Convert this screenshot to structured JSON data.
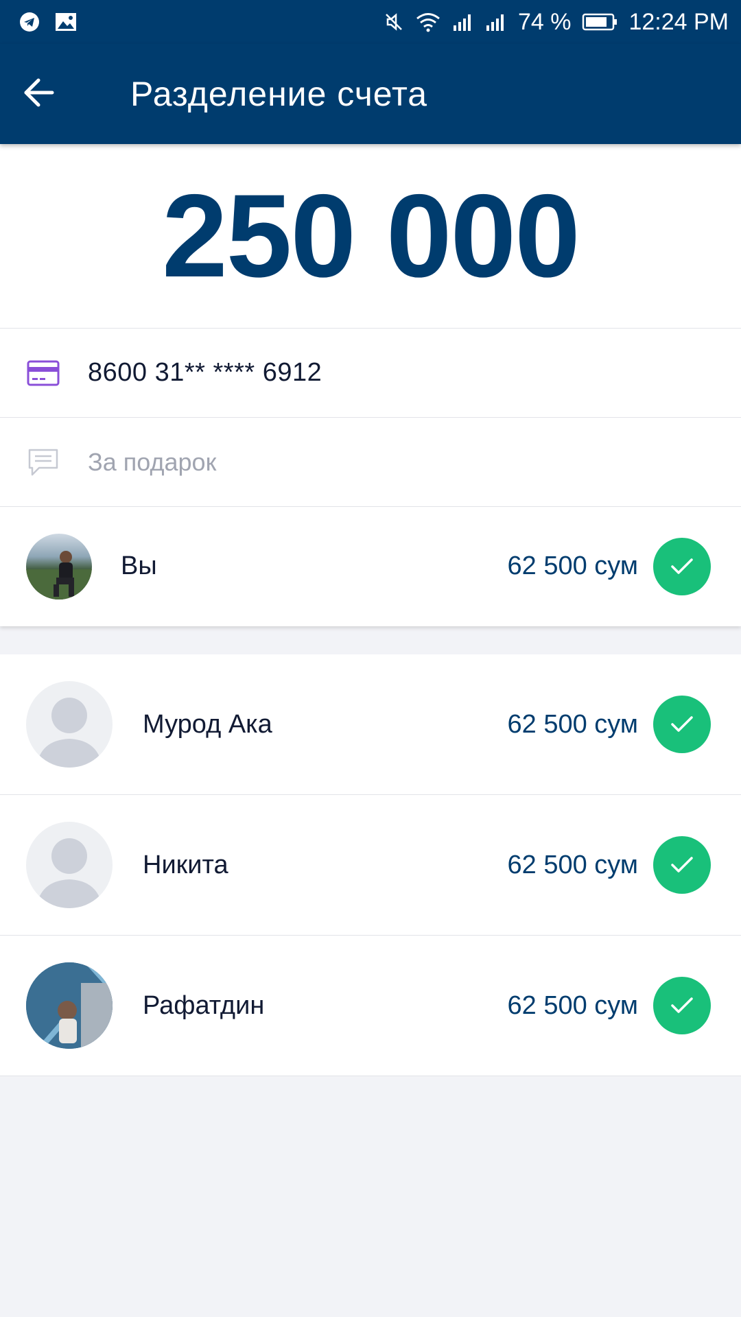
{
  "status_bar": {
    "battery": "74 %",
    "time": "12:24 PM",
    "icons": [
      "telegram-icon",
      "gallery-icon",
      "mute-icon",
      "wifi-icon",
      "signal-icon",
      "signal-icon",
      "battery-icon"
    ]
  },
  "header": {
    "title": "Разделение счета",
    "back_icon": "arrow-left-icon"
  },
  "total": {
    "amount": "250 000"
  },
  "card": {
    "number": "8600 31** **** 6912",
    "icon": "credit-card-icon"
  },
  "comment": {
    "text": "За подарок",
    "icon": "chat-bubble-icon"
  },
  "self": {
    "name": "Вы",
    "amount": "62 500 сум",
    "status_icon": "check-icon"
  },
  "participants": [
    {
      "name": "Мурод Ака",
      "amount": "62 500 сум",
      "avatar": "placeholder"
    },
    {
      "name": "Никита",
      "amount": "62 500 сум",
      "avatar": "placeholder"
    },
    {
      "name": "Рафатдин",
      "amount": "62 500 сум",
      "avatar": "photo"
    }
  ],
  "colors": {
    "primary": "#003c6e",
    "success": "#19c07a",
    "card_icon": "#8a4fd8",
    "background": "#f2f3f7"
  }
}
